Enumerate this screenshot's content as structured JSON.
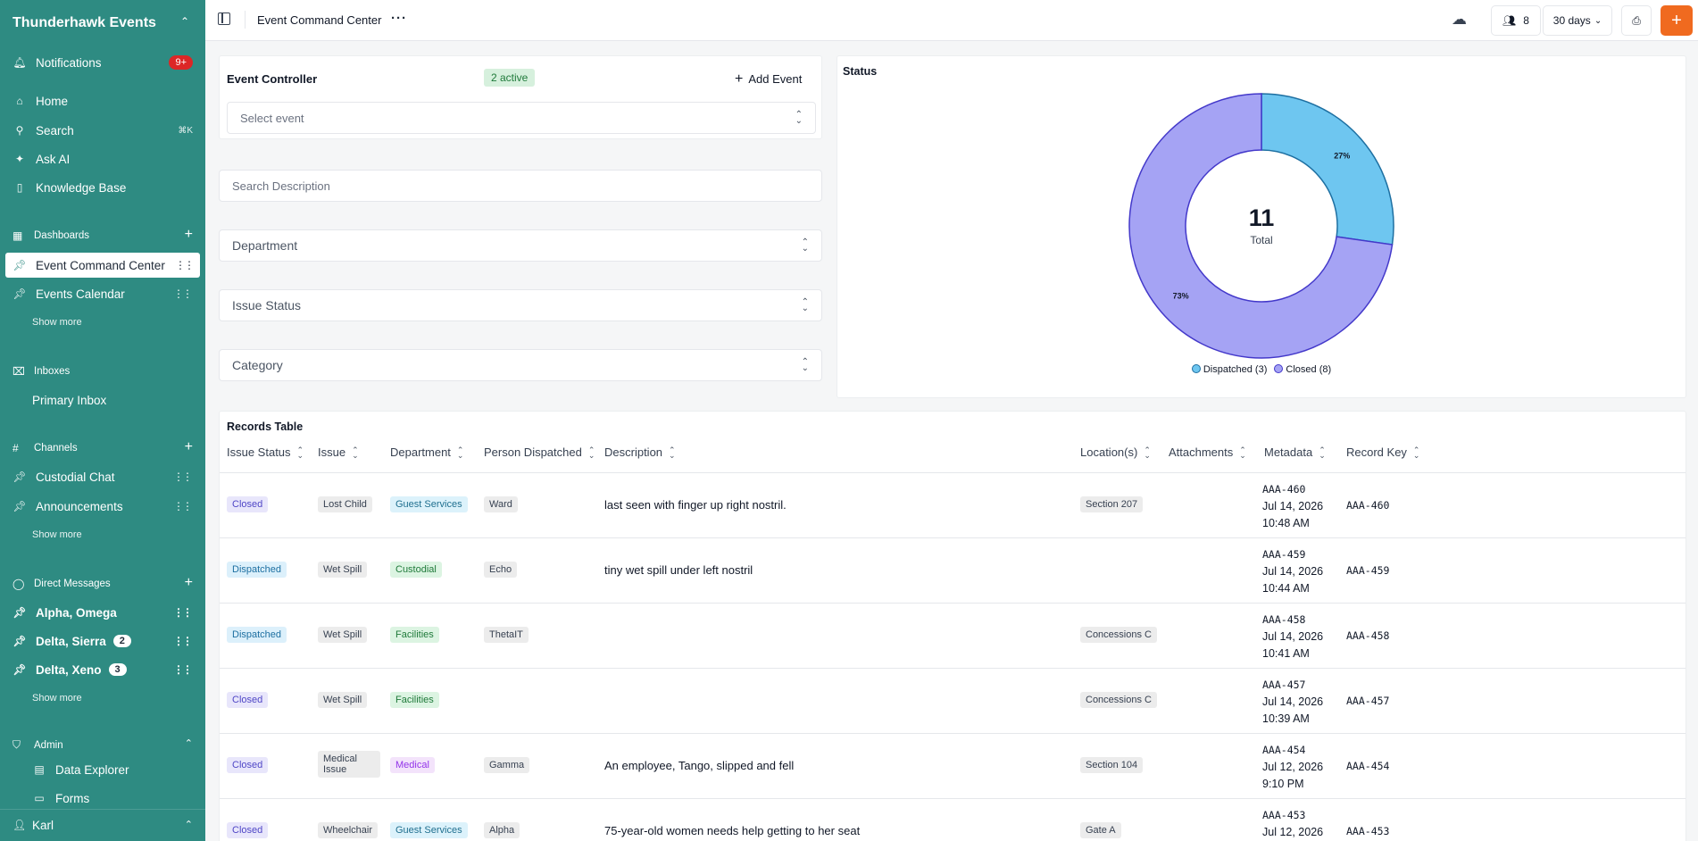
{
  "sidebar": {
    "brand": "Thunderhawk Events",
    "notifications": {
      "label": "Notifications",
      "badge": "9+"
    },
    "home": "Home",
    "search": {
      "label": "Search",
      "shortcut": "⌘K"
    },
    "ask_ai": "Ask AI",
    "knowledge_base": "Knowledge Base",
    "dashboards": {
      "header": "Dashboards",
      "items": [
        "Event Command Center",
        "Events Calendar"
      ],
      "show_more": "Show more"
    },
    "inboxes": {
      "header": "Inboxes",
      "items": [
        "Primary Inbox"
      ]
    },
    "channels": {
      "header": "Channels",
      "items": [
        "Custodial Chat",
        "Announcements"
      ],
      "show_more": "Show more"
    },
    "direct_messages": {
      "header": "Direct Messages",
      "items": [
        {
          "label": "Alpha, Omega",
          "badge": ""
        },
        {
          "label": "Delta, Sierra",
          "badge": "2"
        },
        {
          "label": "Delta, Xeno",
          "badge": "3"
        }
      ],
      "show_more": "Show more"
    },
    "admin": {
      "header": "Admin",
      "items": [
        "Data Explorer",
        "Forms"
      ]
    },
    "user": "Karl"
  },
  "topbar": {
    "title": "Event Command Center",
    "users_count": "8",
    "range": "30 days",
    "accent": "#f06a1f"
  },
  "event_controller": {
    "title": "Event Controller",
    "active_badge": "2 active",
    "add_event": "Add Event",
    "select_placeholder": "Select event"
  },
  "filters": {
    "search_placeholder": "Search Description",
    "department": "Department",
    "issue_status": "Issue Status",
    "category": "Category"
  },
  "status_chart": {
    "title": "Status",
    "center_value": "11",
    "center_label": "Total",
    "legend": [
      "Dispatched (3)",
      "Closed (8)"
    ]
  },
  "chart_data": {
    "type": "pie",
    "title": "Status",
    "categories": [
      "Dispatched",
      "Closed"
    ],
    "values": [
      3,
      8
    ],
    "labels": [
      "27%",
      "73%"
    ],
    "colors": [
      "#6ec6f0",
      "#a5a3f4"
    ],
    "stroke_colors": [
      "#1d6fa1",
      "#4338ca"
    ],
    "legend_placement": "bottom"
  },
  "table": {
    "title": "Records Table",
    "columns": [
      "Issue Status",
      "Issue",
      "Department",
      "Person Dispatched",
      "Description",
      "Location(s)",
      "Attachments",
      "Metadata",
      "Record Key"
    ],
    "rows": [
      {
        "status": "Closed",
        "issue": "Lost Child",
        "department": "Guest Services",
        "person": "Ward",
        "description": "last seen with finger up right nostril.",
        "location": "Section 207",
        "meta_id": "AAA-460",
        "meta_date": "Jul 14, 2026",
        "meta_time": "10:48 AM",
        "key": "AAA-460"
      },
      {
        "status": "Dispatched",
        "issue": "Wet Spill",
        "department": "Custodial",
        "person": "Echo",
        "description": "tiny wet spill under left nostril",
        "location": "",
        "meta_id": "AAA-459",
        "meta_date": "Jul 14, 2026",
        "meta_time": "10:44 AM",
        "key": "AAA-459"
      },
      {
        "status": "Dispatched",
        "issue": "Wet Spill",
        "department": "Facilities",
        "person": "ThetaIT",
        "description": "",
        "location": "Concessions C",
        "meta_id": "AAA-458",
        "meta_date": "Jul 14, 2026",
        "meta_time": "10:41 AM",
        "key": "AAA-458"
      },
      {
        "status": "Closed",
        "issue": "Wet Spill",
        "department": "Facilities",
        "person": "",
        "description": "",
        "location": "Concessions C",
        "meta_id": "AAA-457",
        "meta_date": "Jul 14, 2026",
        "meta_time": "10:39 AM",
        "key": "AAA-457"
      },
      {
        "status": "Closed",
        "issue": "Medical Issue",
        "department": "Medical",
        "person": "Gamma",
        "description": "An employee, Tango, slipped and fell",
        "location": "Section 104",
        "meta_id": "AAA-454",
        "meta_date": "Jul 12, 2026",
        "meta_time": "9:10 PM",
        "key": "AAA-454"
      },
      {
        "status": "Closed",
        "issue": "Wheelchair",
        "department": "Guest Services",
        "person": "Alpha",
        "description": "75-year-old women needs help getting to her seat",
        "location": "Gate A",
        "meta_id": "AAA-453",
        "meta_date": "Jul 12, 2026",
        "meta_time": "",
        "key": "AAA-453"
      }
    ]
  }
}
